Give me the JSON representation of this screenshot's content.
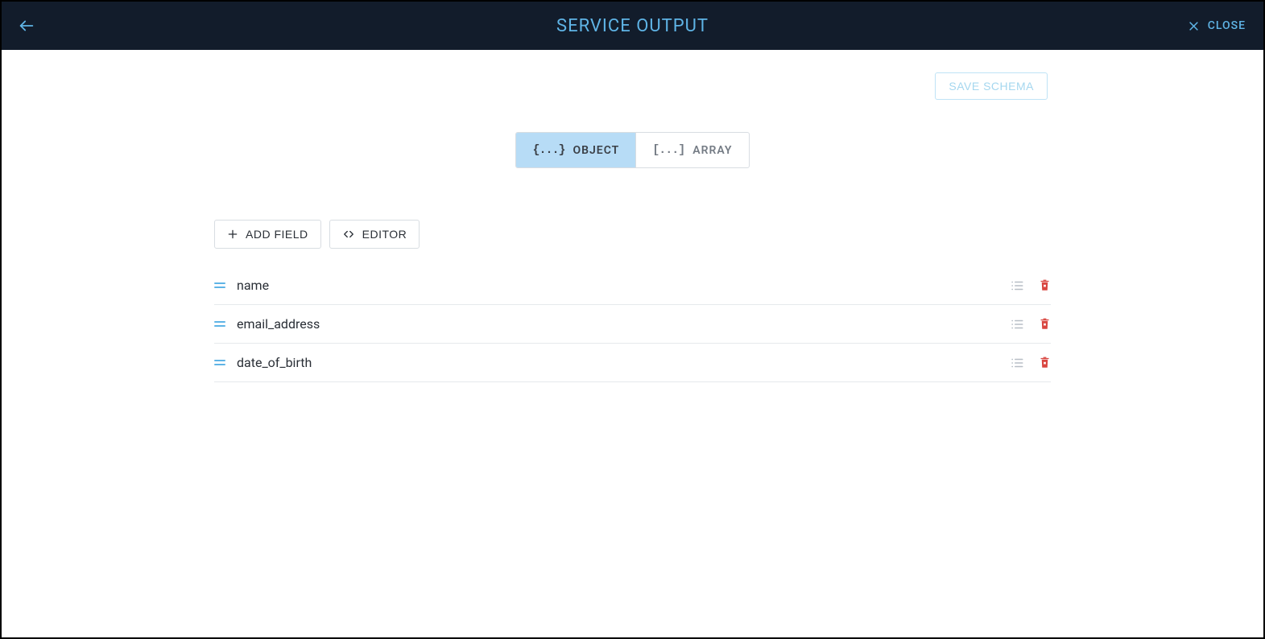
{
  "header": {
    "title": "SERVICE OUTPUT",
    "close_label": "CLOSE"
  },
  "actions": {
    "save_label": "SAVE SCHEMA",
    "add_field_label": "ADD FIELD",
    "editor_label": "EDITOR"
  },
  "type_toggle": {
    "object": {
      "symbol": "{...}",
      "label": "OBJECT"
    },
    "array": {
      "symbol": "[...]",
      "label": "ARRAY"
    }
  },
  "fields": [
    {
      "name": "name"
    },
    {
      "name": "email_address"
    },
    {
      "name": "date_of_birth"
    }
  ]
}
